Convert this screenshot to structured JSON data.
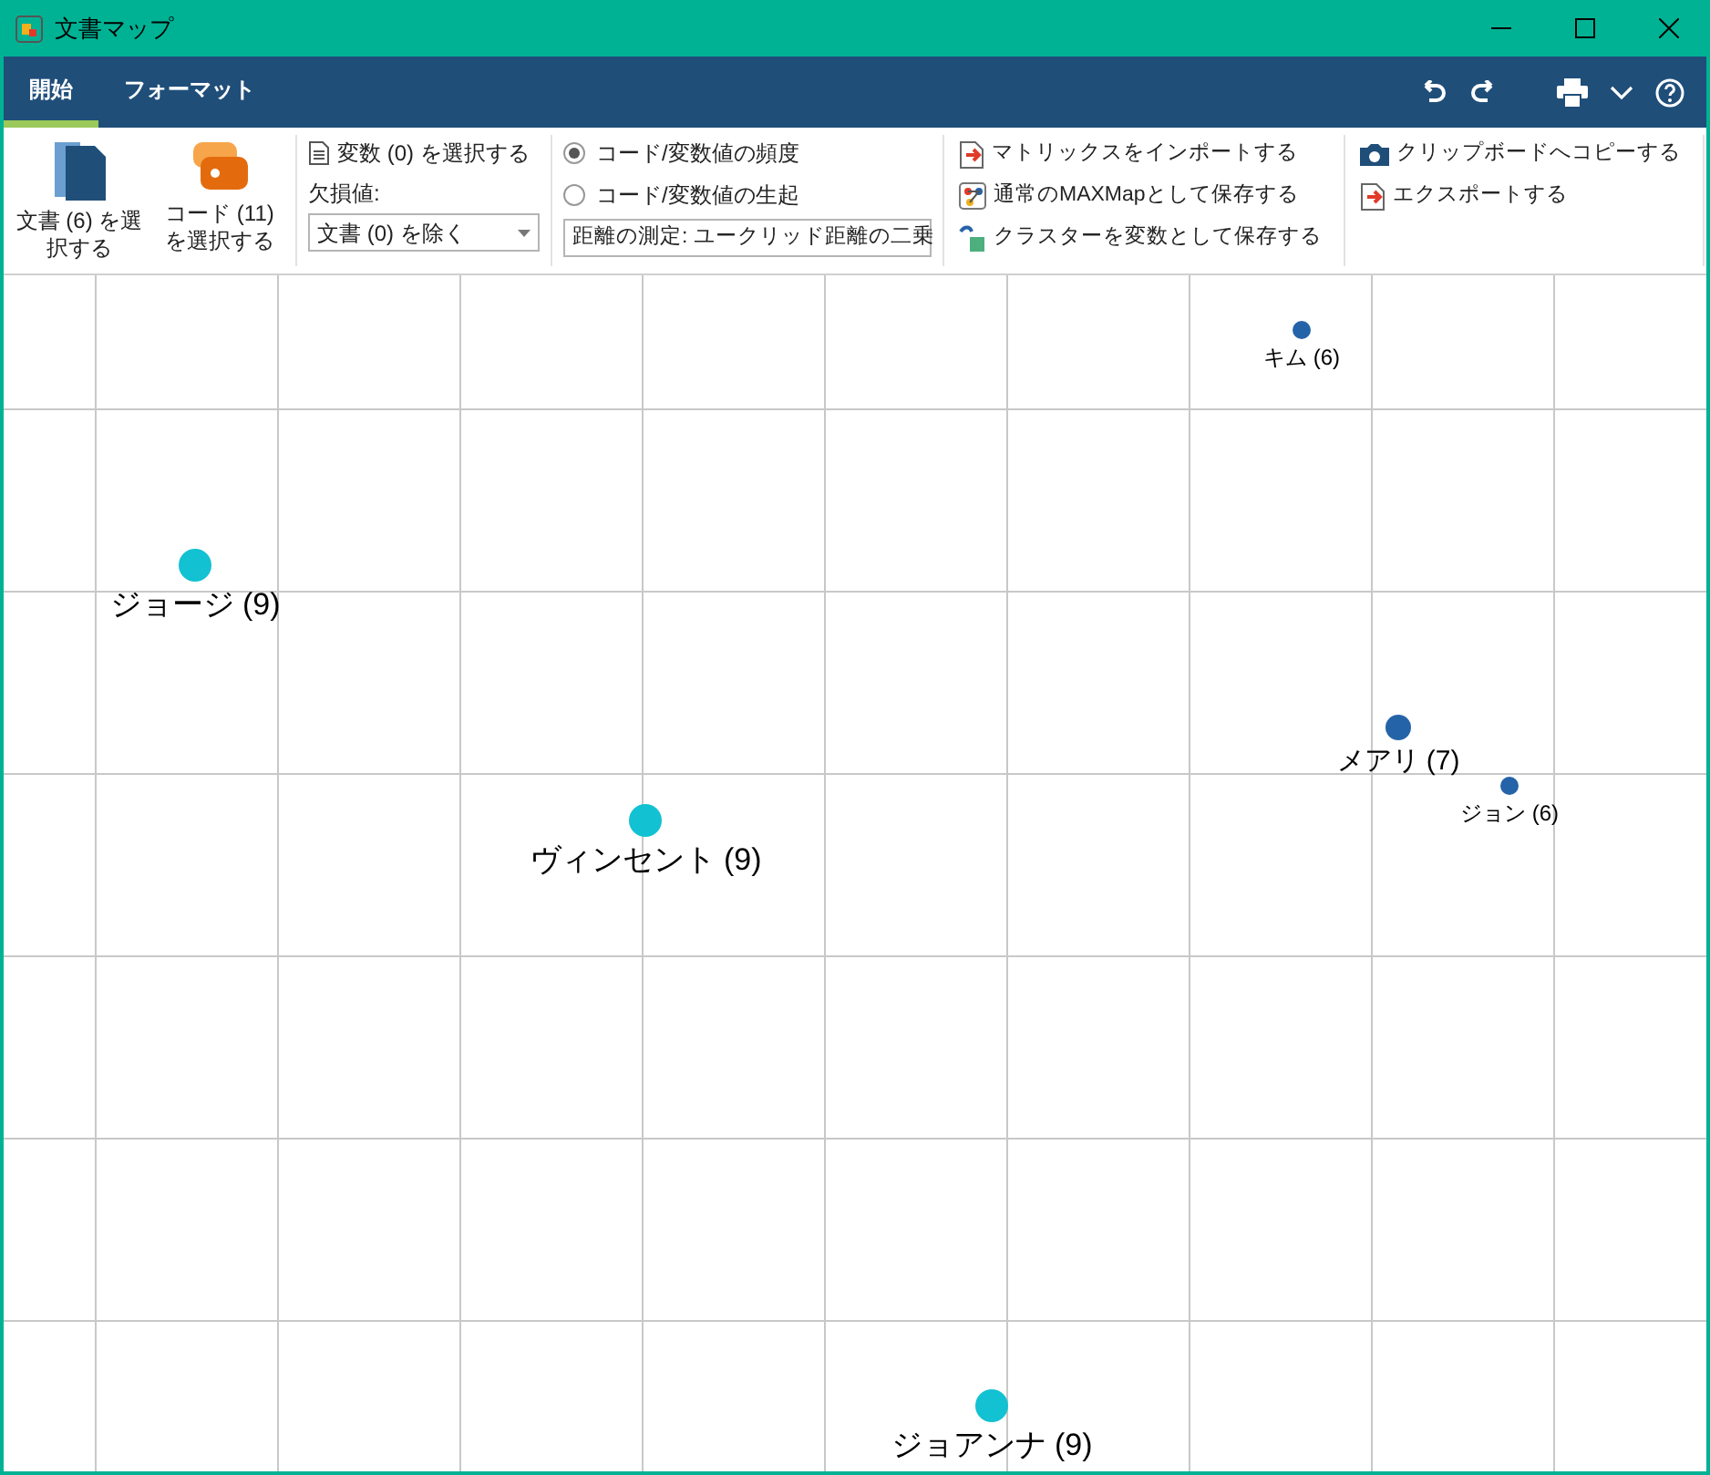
{
  "window": {
    "title": "文書マップ"
  },
  "ribbon": {
    "tabs": [
      {
        "label": "開始",
        "selected": true
      },
      {
        "label": "フォーマット",
        "selected": false
      }
    ]
  },
  "toolbar": {
    "large_buttons": [
      {
        "label": "文書 (6) を選択する",
        "kind": "document"
      },
      {
        "label": "コード (11) を選択する",
        "kind": "code"
      }
    ],
    "variables": {
      "button": "変数 (0) を選択する",
      "missing_label": "欠損値:",
      "missing_value": "文書 (0) を除く"
    },
    "measure": {
      "options": [
        {
          "label": "コード/変数値の頻度",
          "selected": true
        },
        {
          "label": "コード/変数値の生起",
          "selected": false
        }
      ],
      "distance": "距離の測定: ユークリッド距離の二乗"
    },
    "actions": [
      {
        "label": "マトリックスをインポートする",
        "kind": "import"
      },
      {
        "label": "通常のMAXMapとして保存する",
        "kind": "map"
      },
      {
        "label": "クラスターを変数として保存する",
        "kind": "cluster"
      }
    ],
    "output": [
      {
        "label": "クリップボードへコピーする",
        "kind": "camera"
      },
      {
        "label": "エクスポートする",
        "kind": "export"
      }
    ]
  },
  "map": {
    "points": [
      {
        "label": "キム (6)",
        "color": "#2563a8"
      },
      {
        "label": "ジョージ (9)",
        "color": "#12c1d2"
      },
      {
        "label": "メアリ (7)",
        "color": "#2563a8"
      },
      {
        "label": "ジョン (6)",
        "color": "#2563a8"
      },
      {
        "label": "ヴィンセント (9)",
        "color": "#12c1d2"
      },
      {
        "label": "ジョアンナ (9)",
        "color": "#12c1d2"
      }
    ]
  }
}
